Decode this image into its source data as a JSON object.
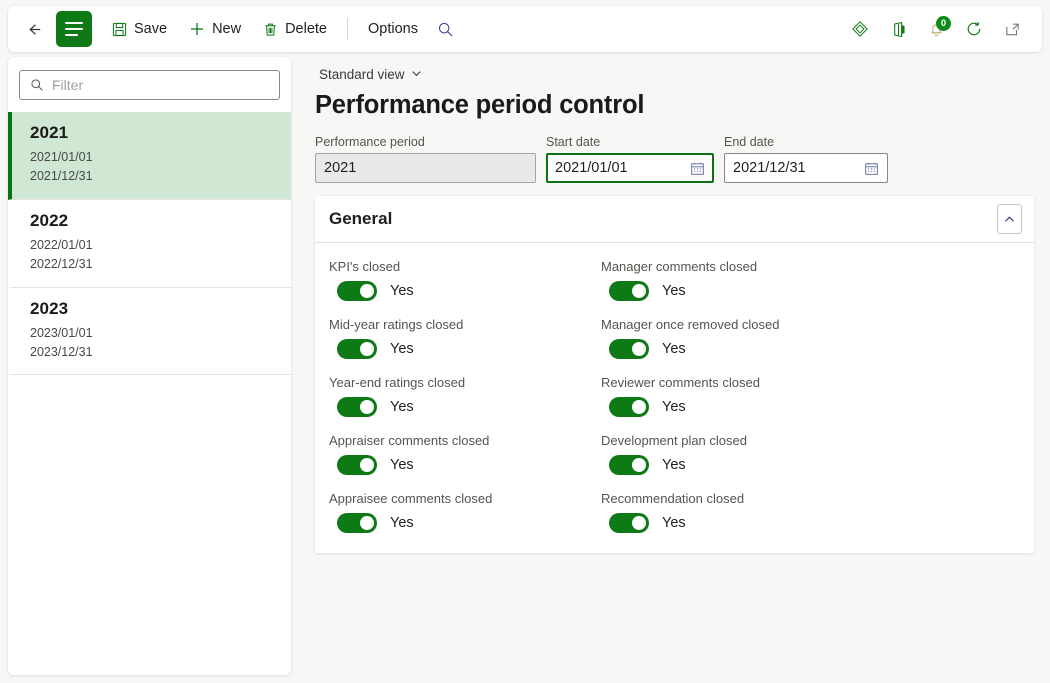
{
  "colors": {
    "brand_green": "#0d7a16",
    "selected_row_bg": "#cfe7d3",
    "selected_row_border": "#0b7214",
    "badge_green": "#0d8a18",
    "page_bg": "#f7f7f5"
  },
  "commandbar": {
    "back_tooltip": "Back",
    "nav_tooltip": "Show navigation pane",
    "save_label": "Save",
    "new_label": "New",
    "delete_label": "Delete",
    "options_label": "Options",
    "search_tooltip": "Search",
    "diamond_tooltip": "Personalize",
    "office_tooltip": "Open in Microsoft Office",
    "notifications_tooltip": "Notifications",
    "notification_count": "0",
    "refresh_tooltip": "Refresh",
    "popout_tooltip": "Open in new window"
  },
  "sidebar": {
    "filter_placeholder": "Filter",
    "filter_value": "",
    "items": [
      {
        "title": "2021",
        "start": "2021/01/01",
        "end": "2021/12/31",
        "selected": true
      },
      {
        "title": "2022",
        "start": "2022/01/01",
        "end": "2022/12/31",
        "selected": false
      },
      {
        "title": "2023",
        "start": "2023/01/01",
        "end": "2023/12/31",
        "selected": false
      }
    ]
  },
  "main": {
    "view_selector": "Standard view",
    "page_title": "Performance period control",
    "fields": {
      "period_label": "Performance period",
      "period_value": "2021",
      "start_label": "Start date",
      "start_value": "2021/01/01",
      "end_label": "End date",
      "end_value": "2021/12/31"
    },
    "general": {
      "title": "General",
      "collapse_tooltip": "Collapse",
      "toggles": [
        {
          "label": "KPI's closed",
          "value": "Yes"
        },
        {
          "label": "Manager comments closed",
          "value": "Yes"
        },
        {
          "label": "Mid-year ratings closed",
          "value": "Yes"
        },
        {
          "label": "Manager once removed closed",
          "value": "Yes"
        },
        {
          "label": "Year-end ratings closed",
          "value": "Yes"
        },
        {
          "label": "Reviewer comments closed",
          "value": "Yes"
        },
        {
          "label": "Appraiser comments closed",
          "value": "Yes"
        },
        {
          "label": "Development plan closed",
          "value": "Yes"
        },
        {
          "label": "Appraisee comments closed",
          "value": "Yes"
        },
        {
          "label": "Recommendation closed",
          "value": "Yes"
        }
      ]
    }
  }
}
